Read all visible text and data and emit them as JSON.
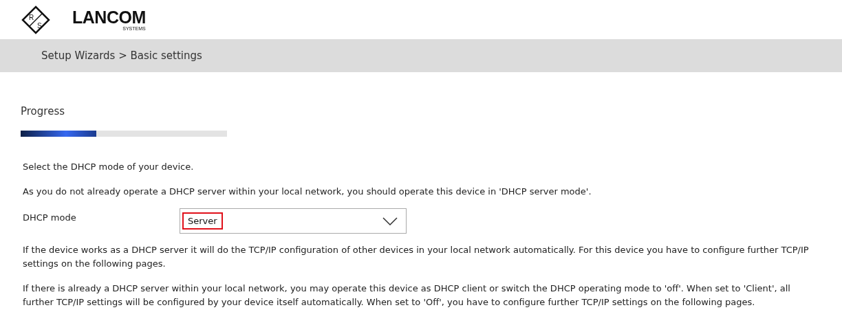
{
  "logo": {
    "emblem_letters": [
      "R",
      "S"
    ],
    "name": "LANCOM",
    "subtitle": "SYSTEMS"
  },
  "breadcrumb": "Setup Wizards > Basic settings",
  "progress": {
    "label": "Progress",
    "level": 0.367
  },
  "intro": "Select the DHCP mode of your device.",
  "recommendation": "As you do not already operate a DHCP server within your local network, you should operate this device in 'DHCP server mode'.",
  "dhcp_mode": {
    "label": "DHCP mode",
    "value": "Server",
    "highlighted": true
  },
  "paragraphs": [
    "If the device works as a DHCP server it will do the TCP/IP configuration of other devices in your local network automatically. For this device you have to configure further TCP/IP settings on the following pages.",
    "If there is already a DHCP server within your local network, you may operate this device as DHCP client or switch the DHCP operating mode to 'off'. When set to 'Client', all further TCP/IP settings will be configured by your device itself automatically. When set to 'Off', you have to configure further TCP/IP settings on the following pages."
  ]
}
